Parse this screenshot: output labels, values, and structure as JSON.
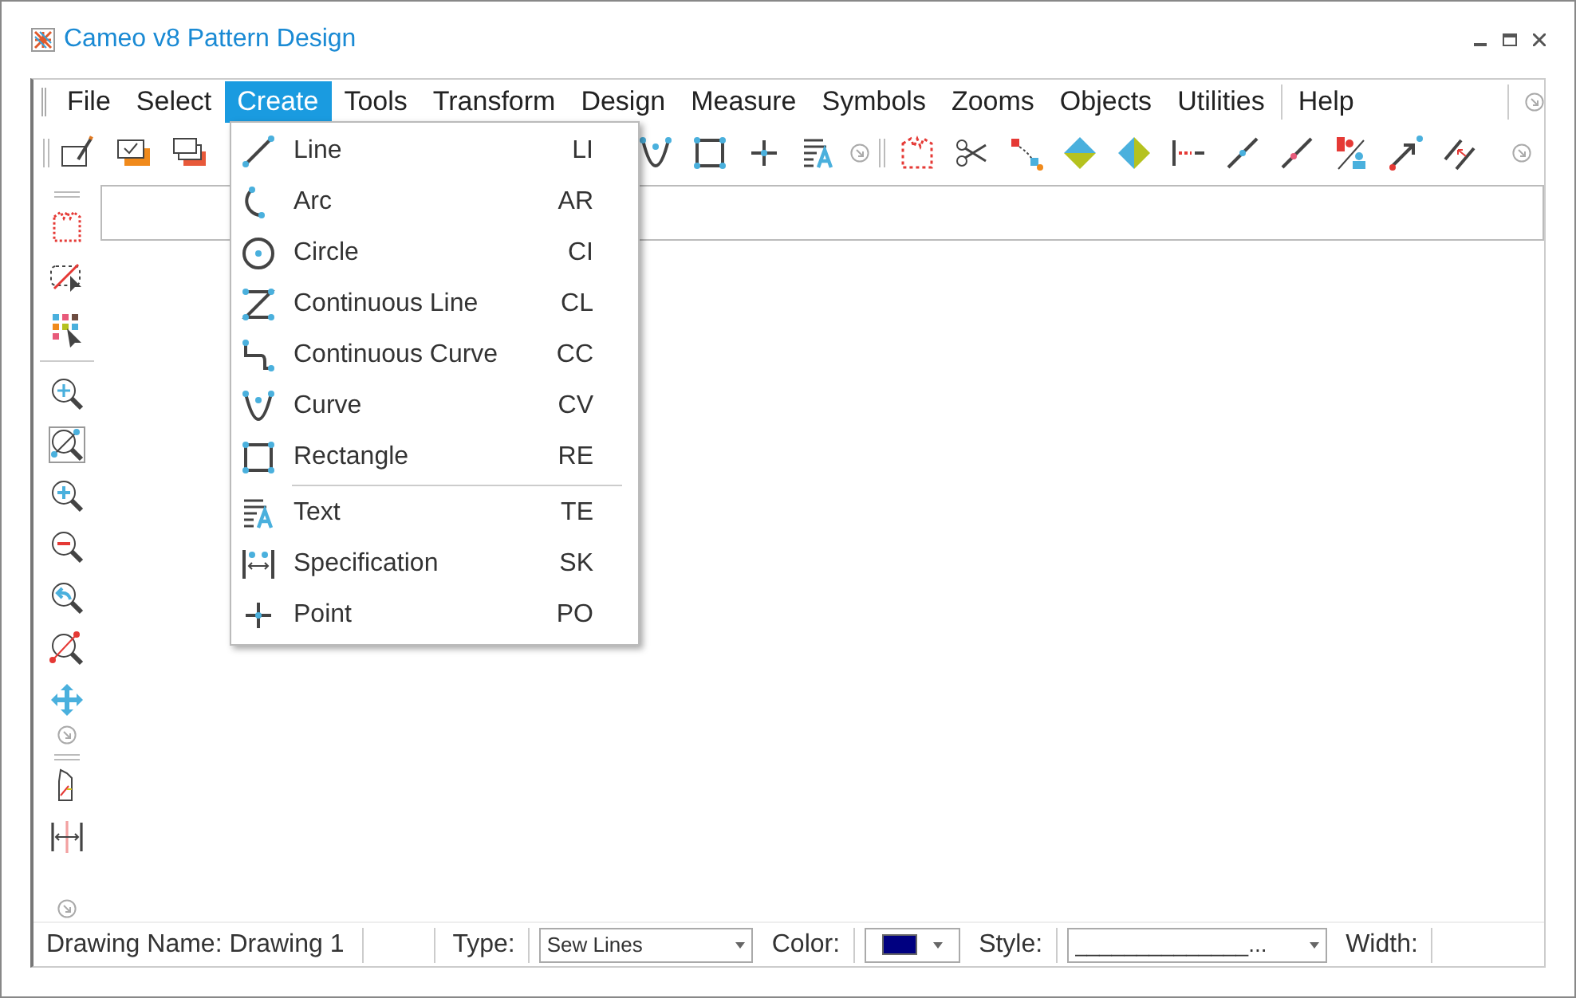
{
  "window": {
    "title": "Cameo v8 Pattern Design"
  },
  "menubar": [
    {
      "label": "File",
      "selected": false
    },
    {
      "label": "Select",
      "selected": false
    },
    {
      "label": "Create",
      "selected": true
    },
    {
      "label": "Tools",
      "selected": false
    },
    {
      "label": "Transform",
      "selected": false
    },
    {
      "label": "Design",
      "selected": false
    },
    {
      "label": "Measure",
      "selected": false
    },
    {
      "label": "Symbols",
      "selected": false
    },
    {
      "label": "Zooms",
      "selected": false
    },
    {
      "label": "Objects",
      "selected": false
    },
    {
      "label": "Utilities",
      "selected": false
    },
    {
      "label": "Help",
      "selected": false
    }
  ],
  "create_menu": [
    {
      "kind": "line",
      "label": "Line",
      "shortcut": "LI",
      "separator_before": false
    },
    {
      "kind": "arc",
      "label": "Arc",
      "shortcut": "AR",
      "separator_before": false
    },
    {
      "kind": "circle",
      "label": "Circle",
      "shortcut": "CI",
      "separator_before": false
    },
    {
      "kind": "cline",
      "label": "Continuous Line",
      "shortcut": "CL",
      "separator_before": false
    },
    {
      "kind": "ccurve",
      "label": "Continuous Curve",
      "shortcut": "CC",
      "separator_before": false
    },
    {
      "kind": "curve",
      "label": "Curve",
      "shortcut": "CV",
      "separator_before": false
    },
    {
      "kind": "rect",
      "label": "Rectangle",
      "shortcut": "RE",
      "separator_before": false
    },
    {
      "kind": "text",
      "label": "Text",
      "shortcut": "TE",
      "separator_before": true
    },
    {
      "kind": "spec",
      "label": "Specification",
      "shortcut": "SK",
      "separator_before": false
    },
    {
      "kind": "point",
      "label": "Point",
      "shortcut": "PO",
      "separator_before": false
    }
  ],
  "status_bar": {
    "drawing_name": "Drawing Name: Drawing 1",
    "type_label": "Type:",
    "type_value": "Sew Lines",
    "color_label": "Color:",
    "color": "#000080",
    "style_label": "Style:",
    "style_value": "______________...",
    "width_label": "Width:"
  }
}
